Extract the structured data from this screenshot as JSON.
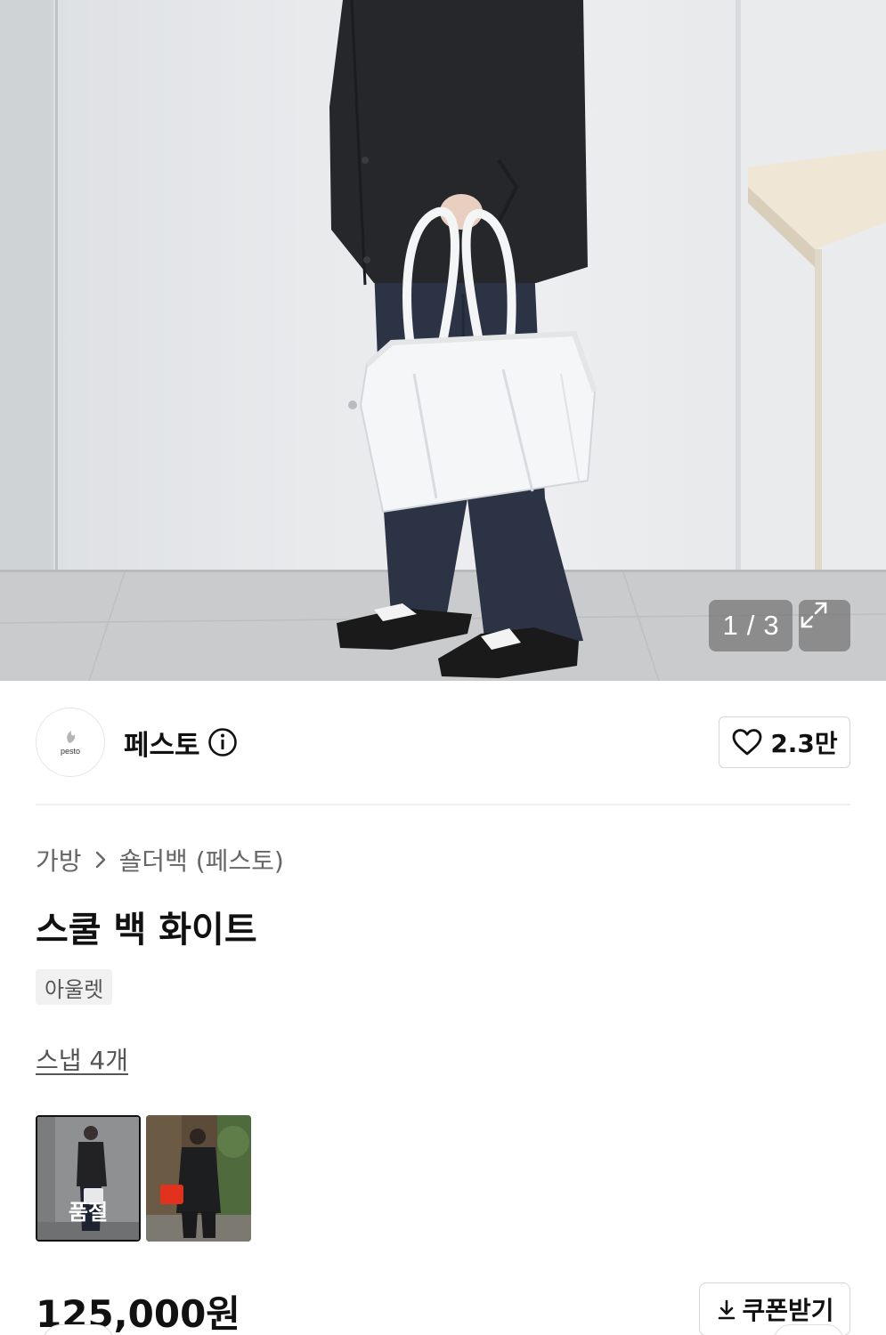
{
  "gallery": {
    "current": "1",
    "separator": "/",
    "total": "3",
    "expand_icon": "expand-icon"
  },
  "brand": {
    "logo_text": "pesto",
    "name": "페스토",
    "info_icon": "info-icon",
    "like_icon": "heart-icon",
    "like_count": "2.3만"
  },
  "product": {
    "breadcrumb": [
      {
        "label": "가방"
      },
      {
        "label": "숄더백 (페스토)"
      }
    ],
    "breadcrumb_separator_icon": "chevron-right-icon",
    "title": "스쿨 백 화이트",
    "badge": "아울렛"
  },
  "snaps": {
    "link_label": "스냅 4개",
    "items": [
      {
        "status": "품절",
        "selected": true
      },
      {
        "status": "",
        "selected": false
      }
    ]
  },
  "price": {
    "amount": "125,000원"
  },
  "coupon": {
    "icon": "download-icon",
    "label": "쿠폰받기"
  },
  "colors": {
    "text": "#111111",
    "muted": "#666666",
    "border": "#d6d6d6",
    "badge_bg": "#f1f1f1"
  }
}
